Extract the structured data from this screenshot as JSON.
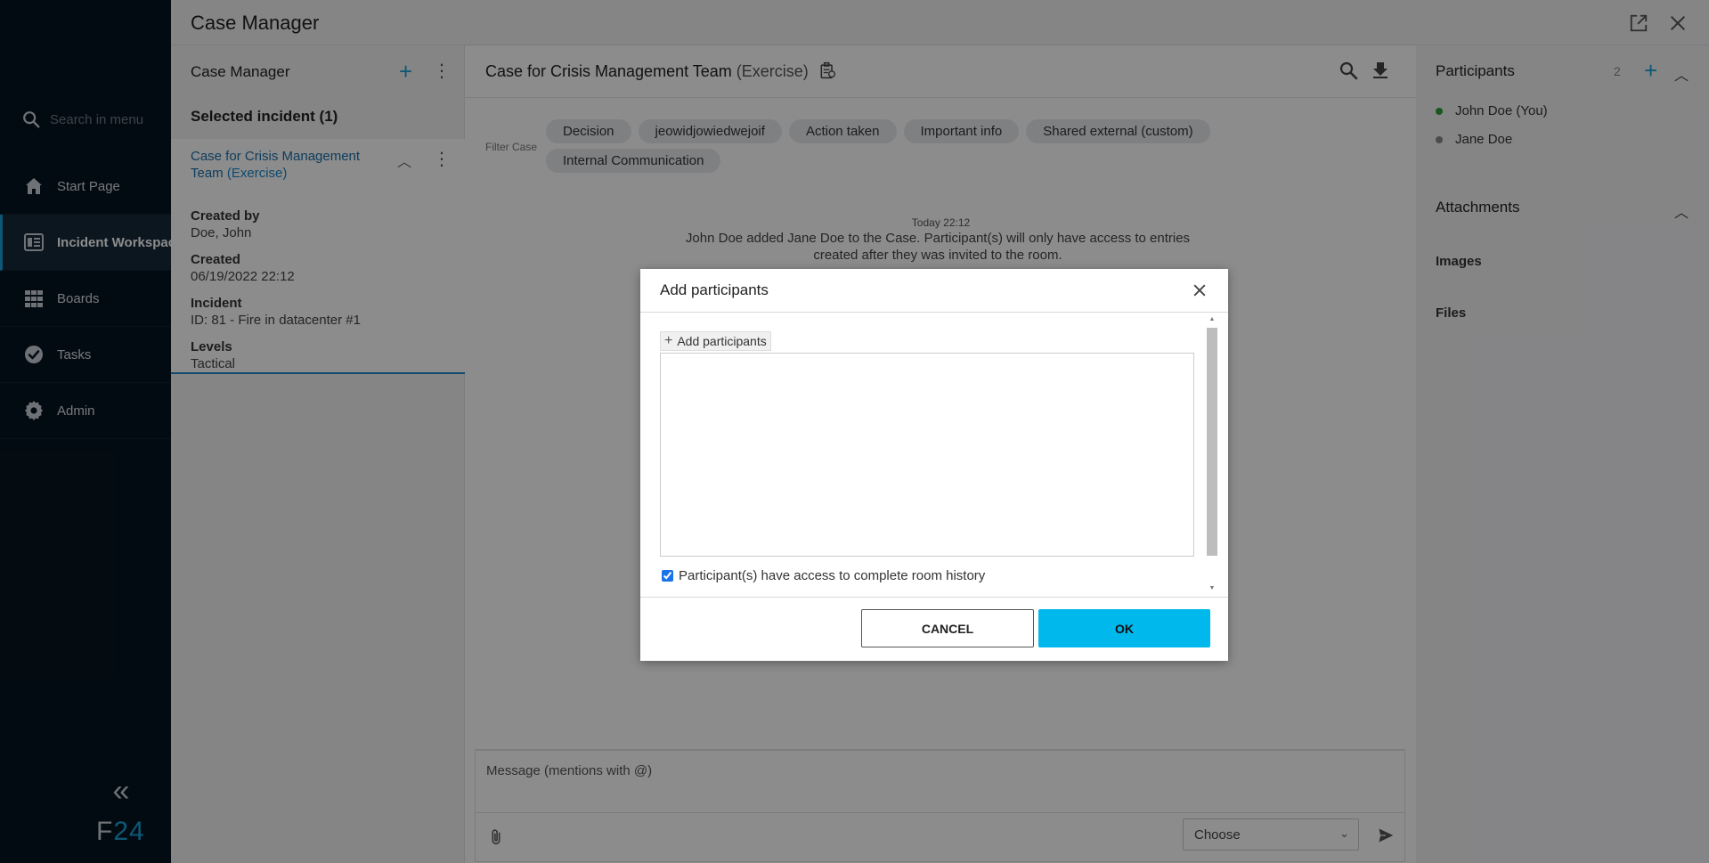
{
  "sidebar": {
    "search_placeholder": "Search in menu",
    "items": [
      {
        "label": "Start Page",
        "icon": "home-icon"
      },
      {
        "label": "Incident Workspace",
        "icon": "workspace-icon",
        "active": true
      },
      {
        "label": "Boards",
        "icon": "grid-icon"
      },
      {
        "label": "Tasks",
        "icon": "check-circle-icon"
      },
      {
        "label": "Admin",
        "icon": "gear-icon"
      }
    ],
    "collapse_icon": "double-chevron-left-icon",
    "logo": {
      "prefix": "F",
      "suffix": "24"
    }
  },
  "header": {
    "title": "Case Manager"
  },
  "case_panel": {
    "title": "Case Manager",
    "selected_label": "Selected incident (1)",
    "case": {
      "title": "Case for Crisis Management Team",
      "mode": "(Exercise)",
      "fields": [
        {
          "key": "Created by",
          "value": "Doe, John"
        },
        {
          "key": "Created",
          "value": "06/19/2022 22:12"
        },
        {
          "key": "Incident",
          "value": "ID: 81 - Fire in datacenter #1"
        },
        {
          "key": "Levels",
          "value": "Tactical"
        }
      ]
    }
  },
  "chat": {
    "title": "Case for Crisis Management Team",
    "mode": "(Exercise)",
    "filter_label": "Filter Case",
    "chips": [
      "Decision",
      "jeowidjowiedwejoif",
      "Action taken",
      "Important info",
      "Shared external (custom)",
      "Internal Communication"
    ],
    "message": {
      "time": "Today 22:12",
      "text": "John Doe added Jane Doe to the Case. Participant(s) will only have access to entries created after they was invited to the room."
    },
    "input_placeholder": "Message (mentions with @)",
    "select_value": "Choose"
  },
  "right_panel": {
    "participants_title": "Participants",
    "participants_count": "2",
    "participants": [
      {
        "name": "John Doe (You)",
        "status_color": "#2e9e3a"
      },
      {
        "name": "Jane Doe",
        "status_color": "#8a8a8a"
      }
    ],
    "attachments_title": "Attachments",
    "images_label": "Images",
    "files_label": "Files"
  },
  "dialog": {
    "title": "Add participants",
    "add_button_label": "Add participants",
    "history_label": "Participant(s) have access to complete room history",
    "history_checked": true,
    "cancel_label": "CANCEL",
    "ok_label": "OK"
  },
  "colors": {
    "accent": "#00b8ec",
    "sidebar_bg": "#071521",
    "link": "#1a6ea8"
  }
}
